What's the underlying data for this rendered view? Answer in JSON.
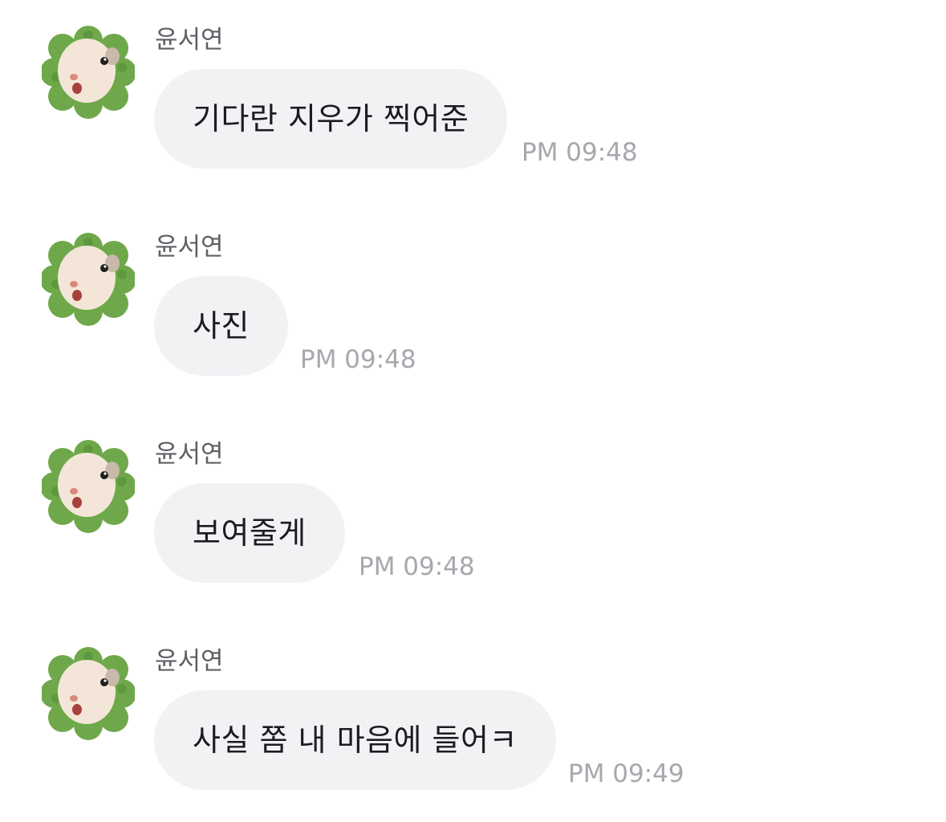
{
  "colors": {
    "bubble_background": "#f2f2f5",
    "message_text": "#1c1c20",
    "sender_name": "#5f6066",
    "timestamp": "#a7a7ae",
    "avatar_leaf_green": "#6fa84a",
    "avatar_hamster_fur": "#f3e6d8"
  },
  "avatar_icon": "hamster-clover-avatar-icon",
  "messages": [
    {
      "sender": "윤서연",
      "text": "기다란 지우가 찍어준",
      "time": "PM 09:48"
    },
    {
      "sender": "윤서연",
      "text": "사진",
      "time": "PM 09:48"
    },
    {
      "sender": "윤서연",
      "text": "보여줄게",
      "time": "PM 09:48"
    },
    {
      "sender": "윤서연",
      "text": "사실 쫌 내 마음에 들어ㅋ",
      "time": "PM 09:49"
    }
  ]
}
